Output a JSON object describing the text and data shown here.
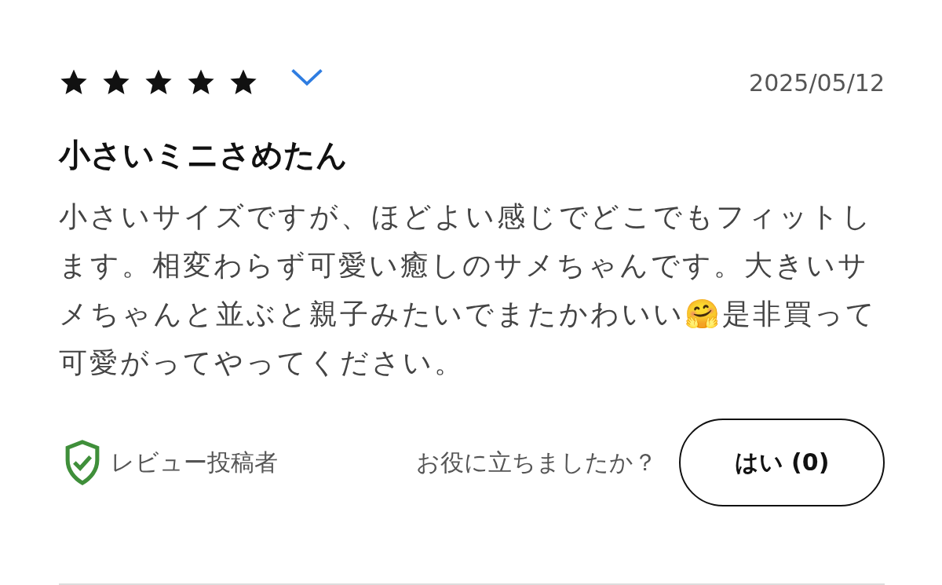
{
  "review": {
    "stars": 5,
    "date": "2025/05/12",
    "title": "小さいミニさめたん",
    "body": "小さいサイズですが、ほどよい感じでどこでもフィットします。相変わらず可愛い癒しのサメちゃんです。大きいサメちゃんと並ぶと親子みたいでまたかわいい🤗是非買って可愛がってやってください。",
    "reviewer_badge": "レビュー投稿者",
    "helpful_question": "お役に立ちましたか？",
    "helpful_button": "はい (0)"
  }
}
